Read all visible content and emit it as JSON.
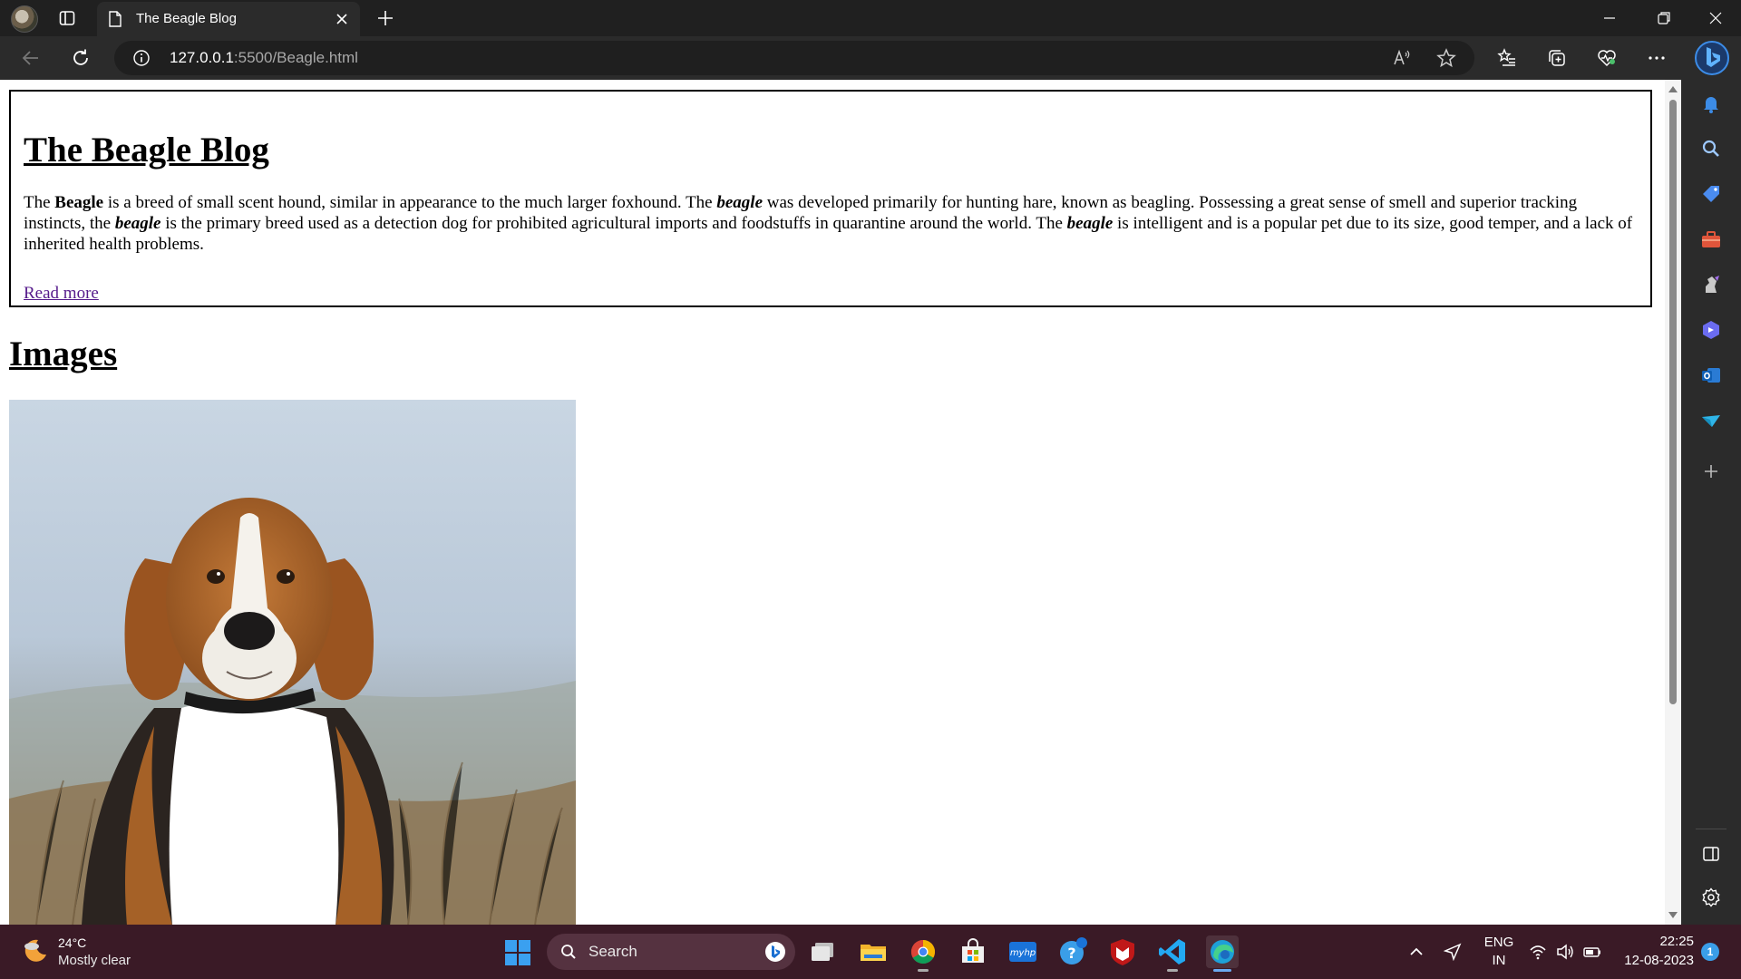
{
  "browser": {
    "tab": {
      "title": "The Beagle Blog"
    },
    "address": {
      "host": "127.0.0.1",
      "path": ":5500/Beagle.html"
    }
  },
  "page": {
    "title": "The Beagle Blog",
    "paragraph": [
      {
        "text": "The ",
        "style": "normal"
      },
      {
        "text": "Beagle",
        "style": "bold"
      },
      {
        "text": " is a breed of small scent hound, similar in appearance to the much larger foxhound. The ",
        "style": "normal"
      },
      {
        "text": "beagle",
        "style": "bold-italic"
      },
      {
        "text": " was developed primarily for hunting hare, known as beagling. Possessing a great sense of smell and superior tracking instincts, the ",
        "style": "normal"
      },
      {
        "text": "beagle",
        "style": "bold-italic"
      },
      {
        "text": " is the primary breed used as a detection dog for prohibited agricultural imports and foodstuffs in quarantine around the world. The ",
        "style": "normal"
      },
      {
        "text": "beagle",
        "style": "bold-italic"
      },
      {
        "text": " is intelligent and is a popular pet due to its size, good temper, and a lack of inherited health problems.",
        "style": "normal"
      }
    ],
    "read_more": "Read more",
    "images_heading": "Images"
  },
  "taskbar": {
    "weather": {
      "temp": "24°C",
      "desc": "Mostly clear"
    },
    "search_label": "Search",
    "lang": {
      "line1": "ENG",
      "line2": "IN"
    },
    "clock": {
      "time": "22:25",
      "date": "12-08-2023"
    },
    "notification_count": "1"
  }
}
